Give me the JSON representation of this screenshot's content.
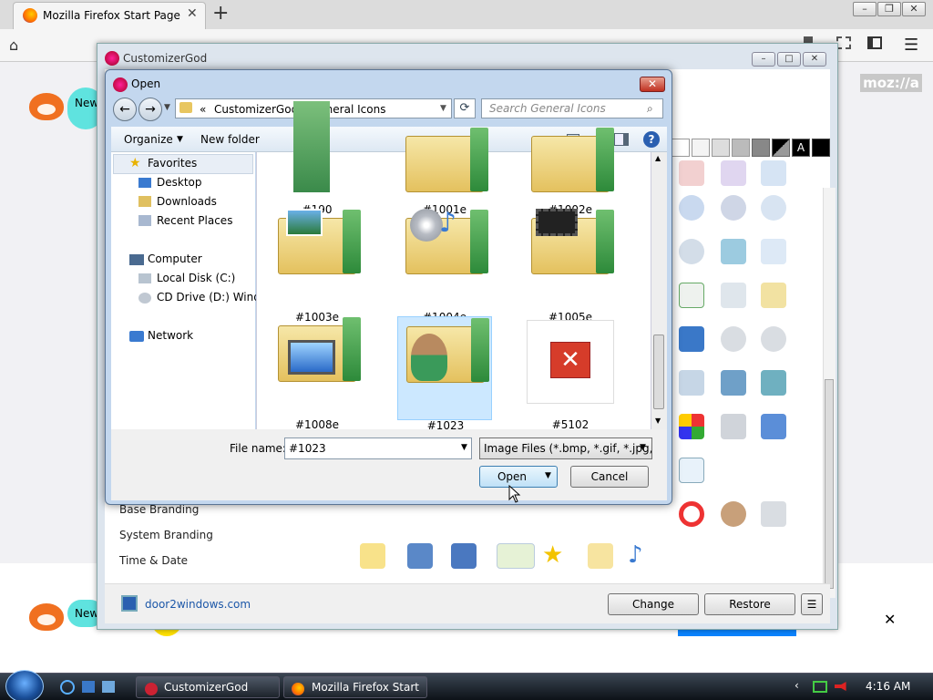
{
  "firefox": {
    "tab_title": "Mozilla Firefox Start Page",
    "tab_close": "✕",
    "new_tab": "+",
    "bubble_text": "New",
    "mozilla_logo": "moz://a",
    "lower_close": "✕"
  },
  "taskbar": {
    "items": [
      "CustomizerGod",
      "Mozilla Firefox Start ..."
    ],
    "time": "4:16 AM"
  },
  "customizer": {
    "title": "CustomizerGod",
    "categories": [
      "Base Branding",
      "System Branding",
      "Time & Date"
    ],
    "link": "door2windows.com",
    "change_label": "Change",
    "restore_label": "Restore",
    "menu_label": "☰"
  },
  "dialog": {
    "title": "Open",
    "close": "✕",
    "path": [
      "«",
      "CustomizerGod",
      "General Icons"
    ],
    "search_placeholder": "Search General Icons",
    "organize_label": "Organize",
    "new_folder_label": "New folder",
    "nav": {
      "favorites": "Favorites",
      "favorites_items": [
        "Desktop",
        "Downloads",
        "Recent Places"
      ],
      "computer": "Computer",
      "computer_items": [
        "Local Disk (C:)",
        "CD Drive (D:) Windo"
      ],
      "network": "Network"
    },
    "files": [
      "#190",
      "#1001e",
      "#1002e",
      "#1003e",
      "#1004e",
      "#1005e",
      "#1008e",
      "#1023",
      "#5102"
    ],
    "selected_file": "#1023",
    "filename_label": "File name:",
    "filename_value": "#1023",
    "filetype_value": "Image Files (*.bmp, *.gif, *.jpg,",
    "open_label": "Open",
    "cancel_label": "Cancel"
  },
  "colors": {
    "dialog_frame": "#c3d7ee",
    "selection": "#cce8ff",
    "firefox_bubble": "#5fe3df"
  }
}
